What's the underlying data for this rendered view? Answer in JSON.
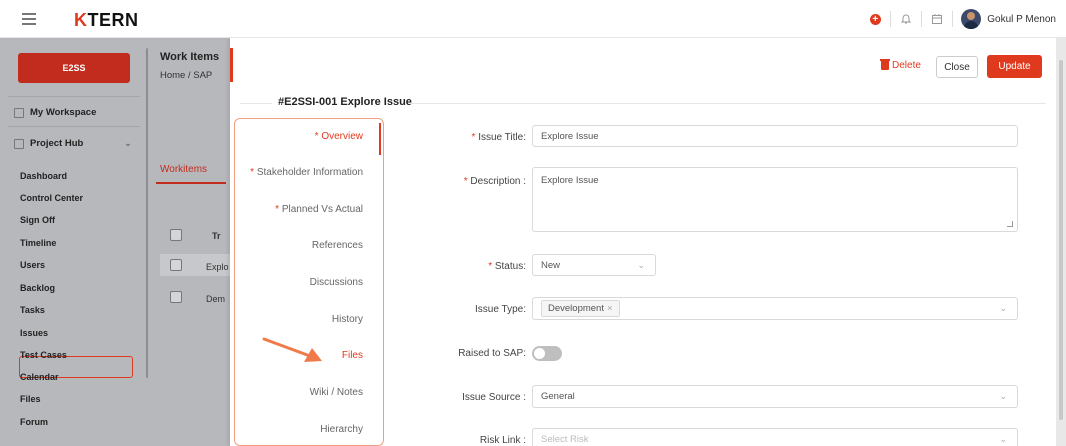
{
  "topbar": {
    "logo_k": "K",
    "logo_rest": "TERN",
    "user_name": "Gokul P Menon",
    "icons": [
      "menu-icon",
      "add-circle-icon",
      "bell-icon",
      "calendar-icon",
      "avatar"
    ]
  },
  "sidebar": {
    "project_button": "E2SS",
    "workspace": "My Workspace",
    "project_hub": "Project Hub",
    "items": [
      "Dashboard",
      "Control Center",
      "Sign Off",
      "Timeline",
      "Users",
      "Backlog",
      "Tasks",
      "Issues",
      "Test Cases",
      "Calendar",
      "Files",
      "Forum"
    ],
    "active_item": "Issues"
  },
  "background": {
    "title": "Work Items",
    "breadcrumb": "Home  /  SAP",
    "tab": "Workitems",
    "col_header": "Tr",
    "rows": [
      "Explo",
      "Dem"
    ]
  },
  "panel": {
    "delete_label": "Delete",
    "close_label": "Close",
    "update_label": "Update",
    "issue_heading": "#E2SSI-001 Explore Issue",
    "tabs": [
      {
        "label": "Overview",
        "required": true,
        "active": true
      },
      {
        "label": "Stakeholder Information",
        "required": true,
        "active": false
      },
      {
        "label": "Planned Vs Actual",
        "required": true,
        "active": false
      },
      {
        "label": "References",
        "required": false,
        "active": false
      },
      {
        "label": "Discussions",
        "required": false,
        "active": false
      },
      {
        "label": "History",
        "required": false,
        "active": false
      },
      {
        "label": "Files",
        "required": false,
        "active": false,
        "highlighted": true
      },
      {
        "label": "Wiki / Notes",
        "required": false,
        "active": false
      },
      {
        "label": "Hierarchy",
        "required": false,
        "active": false
      }
    ],
    "form": {
      "issue_title_label": "Issue Title:",
      "issue_title_value": "Explore Issue",
      "description_label": "Description :",
      "description_value": "Explore Issue",
      "status_label": "Status:",
      "status_value": "New",
      "issue_type_label": "Issue Type:",
      "issue_type_tag": "Development",
      "raised_label": "Raised to SAP:",
      "raised_value": false,
      "issue_source_label": "Issue Source :",
      "issue_source_value": "General",
      "risk_link_label": "Risk Link :",
      "risk_link_placeholder": "Select Risk"
    }
  },
  "colors": {
    "accent": "#e03a1e",
    "project_button": "#c12c1f",
    "overlay": "#b7b8bc"
  }
}
